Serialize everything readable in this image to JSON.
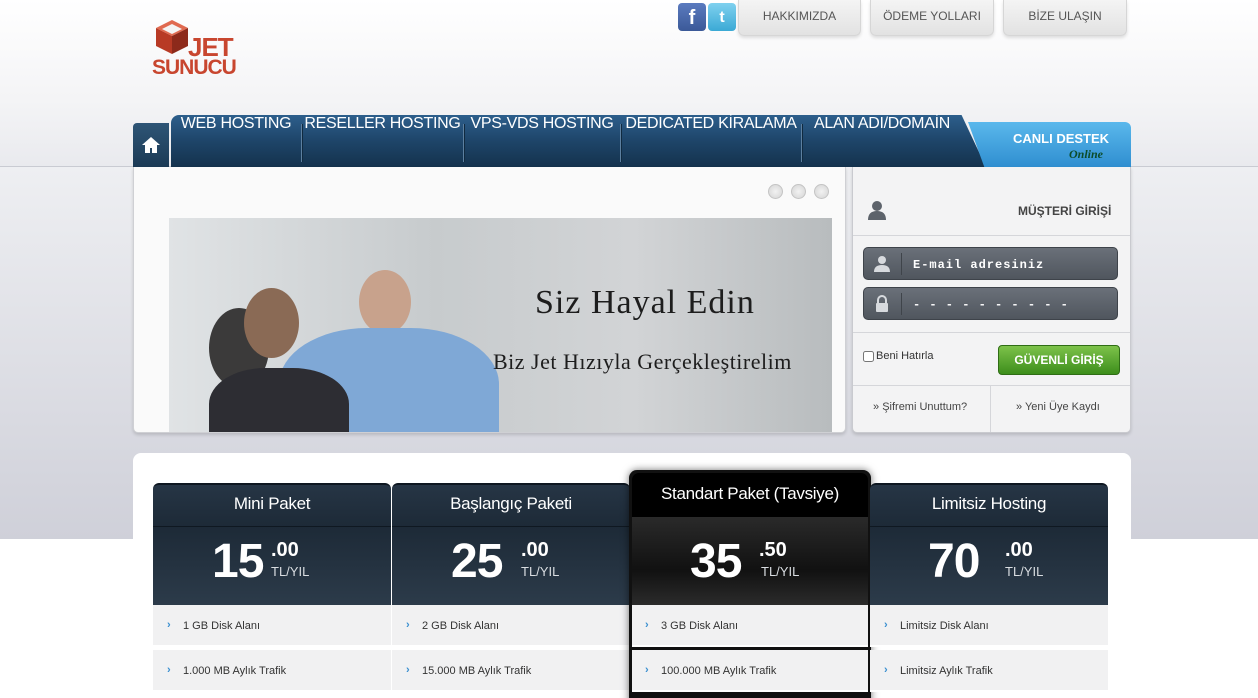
{
  "brand": {
    "line1": "JET",
    "line2": "SUNUCU"
  },
  "social": {
    "facebook": "f",
    "twitter": "t"
  },
  "top_links": [
    "HAKKIMIZDA",
    "ÖDEME YOLLARI",
    "BİZE ULAŞIN"
  ],
  "nav": {
    "home_icon": "home-icon",
    "items": [
      "WEB HOSTING",
      "RESELLER HOSTING",
      "VPS-VDS HOSTING",
      "DEDICATED KİRALAMA",
      "ALAN ADI/DOMAİN"
    ]
  },
  "live_support": {
    "title": "CANLI DESTEK",
    "status": "Online"
  },
  "banner": {
    "title": "Siz Hayal Edin",
    "subtitle": "Biz Jet Hızıyla Gerçekleştirelim"
  },
  "login": {
    "title": "MÜŞTERİ GİRİŞİ",
    "email_placeholder": "E-mail adresiniz",
    "password_placeholder": "- - - - - - - - - -",
    "remember_label": "Beni Hatırla",
    "submit_label": "GÜVENLİ GİRİŞ",
    "forgot_label": "Şifremi Unuttum?",
    "register_label": "Yeni Üye Kaydı"
  },
  "packages": [
    {
      "name": "Mini Paket",
      "price": "15",
      "cents": ".00",
      "unit": "TL/YIL",
      "features": [
        "1 GB Disk Alanı",
        "1.000 MB Aylık Trafik"
      ]
    },
    {
      "name": "Başlangıç Paketi",
      "price": "25",
      "cents": ".00",
      "unit": "TL/YIL",
      "features": [
        "2 GB Disk Alanı",
        "15.000 MB Aylık Trafik"
      ]
    },
    {
      "name": "Standart Paket (Tavsiye)",
      "price": "35",
      "cents": ".50",
      "unit": "TL/YIL",
      "features": [
        "3 GB Disk Alanı",
        "100.000 MB Aylık Trafik"
      ]
    },
    {
      "name": "Limitsiz Hosting",
      "price": "70",
      "cents": ".00",
      "unit": "TL/YIL",
      "features": [
        "Limitsiz Disk Alanı",
        "Limitsiz Aylık Trafik"
      ]
    }
  ]
}
